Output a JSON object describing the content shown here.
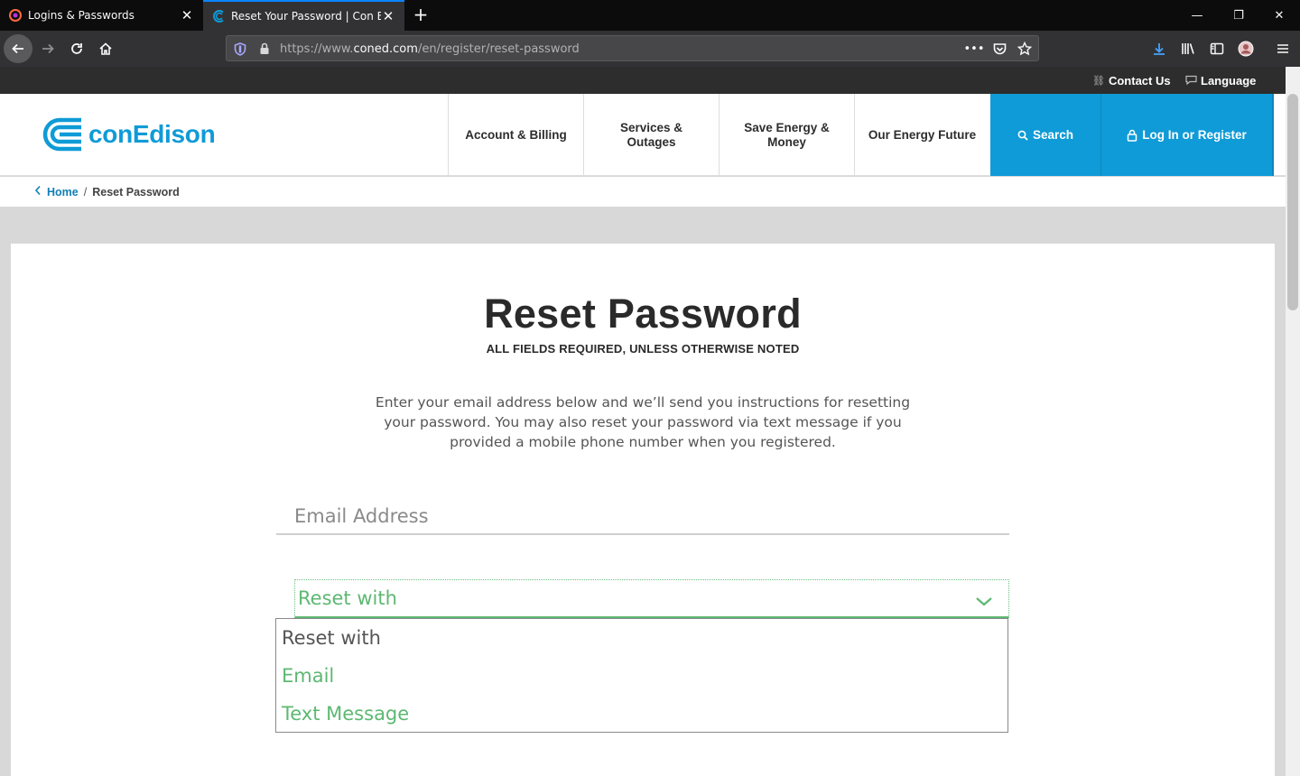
{
  "browser": {
    "tabs": [
      {
        "title": "Logins & Passwords",
        "active": false
      },
      {
        "title": "Reset Your Password | Con Edis",
        "active": true
      }
    ],
    "url": {
      "prefix": "https://www.",
      "host": "coned.com",
      "path": "/en/register/reset-password"
    },
    "window_controls": {
      "minimize": "—",
      "restore": "❐",
      "close": "✕"
    },
    "accent_color": "#0a84ff"
  },
  "site": {
    "brand": {
      "name": "conEdison",
      "color": "#0f9bd7"
    },
    "utility_links": [
      {
        "label": "Contact Us",
        "icon": "link-icon"
      },
      {
        "label": "Language",
        "icon": "speech-bubble-icon"
      }
    ],
    "nav": [
      {
        "label": "Account & Billing"
      },
      {
        "label": "Services & Outages"
      },
      {
        "label": "Save Energy & Money"
      },
      {
        "label": "Our Energy Future"
      }
    ],
    "search_label": "Search",
    "login_label": "Log In or Register",
    "breadcrumb": {
      "home": "Home",
      "separator": "/",
      "current": "Reset Password"
    }
  },
  "form": {
    "title": "Reset Password",
    "subtitle": "ALL FIELDS REQUIRED, UNLESS OTHERWISE NOTED",
    "intro": "Enter your email address below and we’ll send you instructions for resetting your password. You may also reset your password via text message if you provided a mobile phone number when you registered.",
    "email_placeholder": "Email Address",
    "email_value": "",
    "reset_select": {
      "selected": "Reset with",
      "options": [
        "Reset with",
        "Email",
        "Text Message"
      ]
    },
    "focus_color": "#5db872"
  }
}
